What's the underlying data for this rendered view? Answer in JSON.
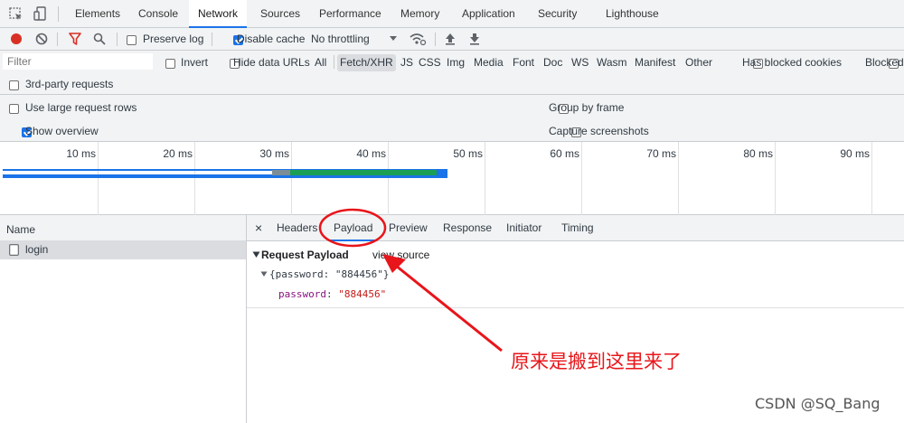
{
  "main_tabs": [
    {
      "label": "Elements"
    },
    {
      "label": "Console"
    },
    {
      "label": "Network"
    },
    {
      "label": "Sources"
    },
    {
      "label": "Performance"
    },
    {
      "label": "Memory"
    },
    {
      "label": "Application"
    },
    {
      "label": "Security"
    },
    {
      "label": "Lighthouse"
    }
  ],
  "toolbar": {
    "preserve_log": "Preserve log",
    "disable_cache": "Disable cache",
    "throttling": "No throttling"
  },
  "filter": {
    "placeholder": "Filter",
    "invert": "Invert",
    "hide_data_urls": "Hide data URLs",
    "types": [
      "All",
      "Fetch/XHR",
      "JS",
      "CSS",
      "Img",
      "Media",
      "Font",
      "Doc",
      "WS",
      "Wasm",
      "Manifest",
      "Other"
    ],
    "has_blocked_cookies": "Has blocked cookies",
    "blocked": "Blocked",
    "third_party": "3rd-party requests"
  },
  "settings": {
    "large_rows": "Use large request rows",
    "show_overview": "Show overview",
    "group_by_frame": "Group by frame",
    "capture_screenshots": "Capture screenshots"
  },
  "overview": {
    "ticks": [
      "10 ms",
      "20 ms",
      "30 ms",
      "40 ms",
      "50 ms",
      "60 ms",
      "70 ms",
      "80 ms",
      "90 ms"
    ]
  },
  "requests": {
    "column_header": "Name",
    "rows": [
      {
        "name": "login"
      }
    ]
  },
  "detail": {
    "tabs": [
      "Headers",
      "Payload",
      "Preview",
      "Response",
      "Initiator",
      "Timing"
    ],
    "close_glyph": "×",
    "payload": {
      "section_title": "Request Payload",
      "view_source": "view source",
      "object_summary": "{password: \"884456\"}",
      "prop_key": "password",
      "prop_sep": ": ",
      "prop_value": "\"884456\""
    }
  },
  "annotation": {
    "text": "原来是搬到这里来了",
    "color": "#e8151a"
  },
  "watermark": "CSDN @SQ_Bang",
  "colors": {
    "record": "#d93025",
    "filter_icon": "#d93025",
    "accent": "#1a73e8",
    "timeline_waiting": "#1a9f55",
    "timeline_blue": "#1a73e8"
  }
}
